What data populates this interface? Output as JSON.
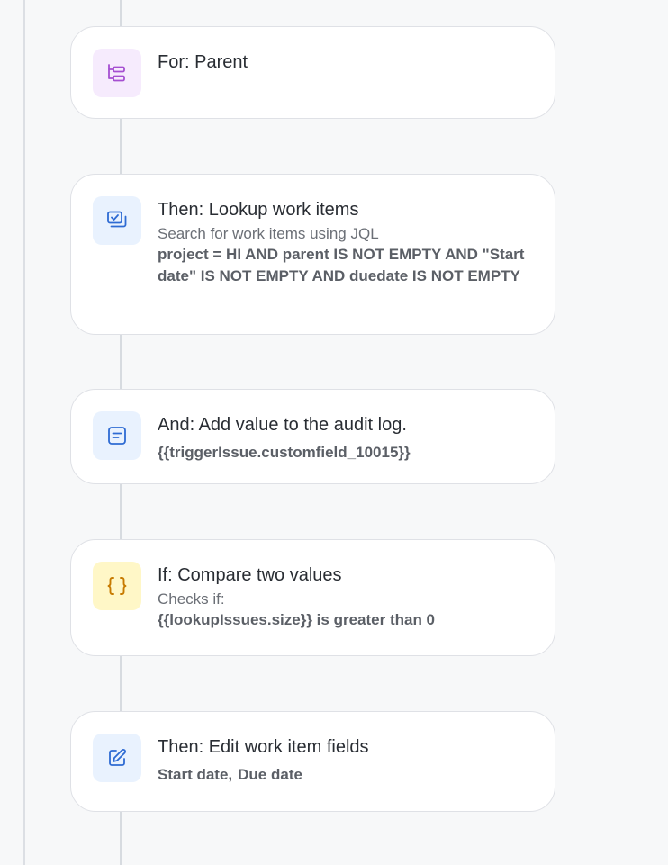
{
  "steps": [
    {
      "icon": "branch-icon",
      "title": "For: Parent"
    },
    {
      "icon": "lookup-icon",
      "title": "Then: Lookup work items",
      "subtitle": "Search for work items using JQL",
      "detail": "project = HI AND parent IS NOT EMPTY AND \"Start date\" IS NOT EMPTY AND duedate IS NOT EMPTY"
    },
    {
      "icon": "audit-log-icon",
      "title": "And: Add value to the audit log.",
      "detail": "{{triggerIssue.customfield_10015}}"
    },
    {
      "icon": "braces-icon",
      "title": "If: Compare two values",
      "subtitle": "Checks if:",
      "detail": "{{lookupIssues.size}} is greater than 0"
    },
    {
      "icon": "edit-icon",
      "title": "Then: Edit work item fields",
      "fields": [
        "Start date,",
        "Due date"
      ]
    }
  ],
  "colors": {
    "purple_icon": "#a54fd1",
    "blue_icon": "#2e6bd3",
    "yellow_icon": "#c77a00"
  }
}
